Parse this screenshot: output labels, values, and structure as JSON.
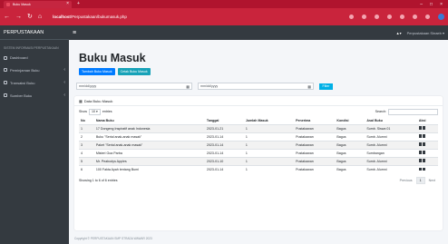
{
  "browser": {
    "tab_title": "Buku Masuk",
    "url_host": "localhost",
    "url_path": "/Perpustakaan/bukumasuk.php",
    "tab_close": "×",
    "new_tab": "+",
    "win_min": "–",
    "win_max": "□",
    "win_close": "×",
    "back": "←",
    "forward": "→",
    "reload": "↻",
    "home": "⌂"
  },
  "sidebar": {
    "brand": "PERPUSTAKAAN",
    "header": "SISTEM INFORMASI PERPUSTAKAAN",
    "items": [
      {
        "label": "Dashboard",
        "chevron": ""
      },
      {
        "label": "Peminjaman Buku",
        "chevron": "‹"
      },
      {
        "label": "Transaksi Buku",
        "chevron": "‹"
      },
      {
        "label": "Sumber Buku",
        "chevron": "‹"
      }
    ]
  },
  "topnav": {
    "menu_icon": "≡",
    "bell": "▲▾",
    "user": "Perpustakaan Sinaeb ▾"
  },
  "page": {
    "title": "Buku Masuk",
    "btn_add": "Tambah Buku Masuk",
    "btn_print": "Cetak Buku Masuk",
    "date_from_placeholder": "mm/dd/yyyy",
    "date_to_placeholder": "mm/dd/yyyy",
    "calendar_icon": "▦",
    "filter_label": "Filter"
  },
  "card": {
    "title": "Data Buku Masuk",
    "show_label": "Show",
    "entries_value": "10 ▾",
    "entries_label": "entries",
    "search_label": "Search:",
    "columns": [
      "No",
      "Nama Buku",
      "Tanggal",
      "Jumlah Masuk",
      "Penerima",
      "Kondisi",
      "Asal Buku",
      "Aksi"
    ],
    "rows": [
      {
        "no": "1",
        "nama": "17 Dongeng Inspiratif anak Indonesia",
        "tanggal": "2023-01-21",
        "jumlah": "1",
        "penerima": "Pustakawan",
        "kondisi": "Bagus",
        "asal": "Sumb. Siswa 01"
      },
      {
        "no": "2",
        "nama": "Buku \"Serial anak-anak masak\"",
        "tanggal": "2023-01-14",
        "jumlah": "1",
        "penerima": "Pustakawan",
        "kondisi": "Bagus",
        "asal": "Sumb. Alumni"
      },
      {
        "no": "3",
        "nama": "Paket \"Serial anak-anak masak\"",
        "tanggal": "2023-01-14",
        "jumlah": "1",
        "penerima": "Pustakawan",
        "kondisi": "Bagus",
        "asal": "Sumb. Alumni"
      },
      {
        "no": "4",
        "nama": "Misteri Goa Parba",
        "tanggal": "2023-01-14",
        "jumlah": "1",
        "penerima": "Pustakawan",
        "kondisi": "Bagus",
        "asal": "Sumbangan"
      },
      {
        "no": "5",
        "nama": "Mr. Peabodys Apples",
        "tanggal": "2023-01-10",
        "jumlah": "1",
        "penerima": "Pustakawan",
        "kondisi": "Bagus",
        "asal": "Sumb. Alumni"
      },
      {
        "no": "6",
        "nama": "100 Fakta Ayah tentang Bumi",
        "tanggal": "2023-01-14",
        "jumlah": "1",
        "penerima": "Pustakawan",
        "kondisi": "Bagus",
        "asal": "Sumb. Alumni"
      }
    ],
    "showing": "Showing 1 to 6 of 6 entries",
    "prev": "Previous",
    "page": "1",
    "next": "Next"
  },
  "footer": {
    "copyright": "Copyright © PERPUSTAKAAN SMP STRADA WAWAR 2023"
  }
}
